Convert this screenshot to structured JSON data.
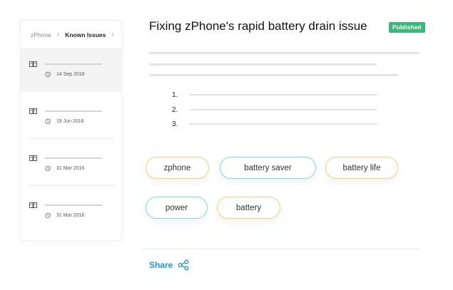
{
  "breadcrumb": {
    "root": "zPhone",
    "current": "Known Issues"
  },
  "sidebar": {
    "articles": [
      {
        "date": "14 Sep 2016",
        "active": true
      },
      {
        "date": "19 Jun 2016",
        "active": false
      },
      {
        "date": "31 Mar 2016",
        "active": false
      },
      {
        "date": "31 Mar 2016",
        "active": false
      }
    ],
    "icons": {
      "article": "book-icon",
      "date": "clock-icon"
    }
  },
  "article": {
    "title": "Fixing zPhone's rapid battery drain issue",
    "status": "Published",
    "status_color": "#3bb77a",
    "list_numbers": [
      "1.",
      "2.",
      "3."
    ]
  },
  "tags": [
    {
      "label": "zphone",
      "color": "#f5cf7a"
    },
    {
      "label": "battery saver",
      "color": "#7fdbd6"
    },
    {
      "label": "battery life",
      "color": "#f5cf7a"
    },
    {
      "label": "power",
      "color": "#7fdbd6"
    },
    {
      "label": "battery",
      "color": "#f5cf7a"
    }
  ],
  "footer": {
    "share_label": "Share",
    "share_icon": "share-icon",
    "accent": "#2196d8"
  }
}
